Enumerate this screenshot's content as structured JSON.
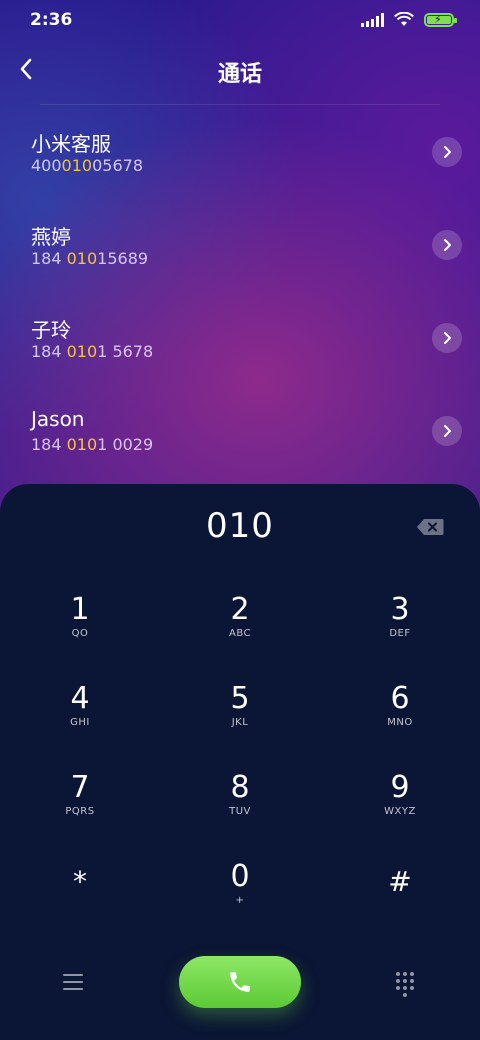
{
  "status": {
    "time": "2:36"
  },
  "header": {
    "title": "通话"
  },
  "contacts": [
    {
      "name": "小米客服",
      "num_pre": "400",
      "num_hl": "010",
      "num_post": "05678"
    },
    {
      "name": "燕婷",
      "num_pre": "184 ",
      "num_hl": "010",
      "num_post": "15689"
    },
    {
      "name": "子玲",
      "num_pre": "184 ",
      "num_hl": "010",
      "num_post": "1 5678"
    },
    {
      "name": "Jason",
      "num_pre": "184 ",
      "num_hl": "010",
      "num_post": "1 0029"
    }
  ],
  "dialer": {
    "input": "010",
    "keys": [
      {
        "digit": "1",
        "letters": "QO"
      },
      {
        "digit": "2",
        "letters": "ABC"
      },
      {
        "digit": "3",
        "letters": "DEF"
      },
      {
        "digit": "4",
        "letters": "GHI"
      },
      {
        "digit": "5",
        "letters": "JKL"
      },
      {
        "digit": "6",
        "letters": "MNO"
      },
      {
        "digit": "7",
        "letters": "PQRS"
      },
      {
        "digit": "8",
        "letters": "TUV"
      },
      {
        "digit": "9",
        "letters": "WXYZ"
      },
      {
        "digit": "*",
        "letters": ""
      },
      {
        "digit": "0",
        "letters": "+"
      },
      {
        "digit": "#",
        "letters": ""
      }
    ]
  },
  "colors": {
    "accent_highlight": "#f4c33b",
    "call_green": "#6fd846",
    "panel_bg": "#0b1535"
  },
  "icons": {
    "back": "chevron-left-icon",
    "row_action": "chevron-right-icon",
    "backspace": "backspace-icon",
    "menu": "menu-icon",
    "call": "phone-icon",
    "keypad": "keypad-grid-icon"
  }
}
